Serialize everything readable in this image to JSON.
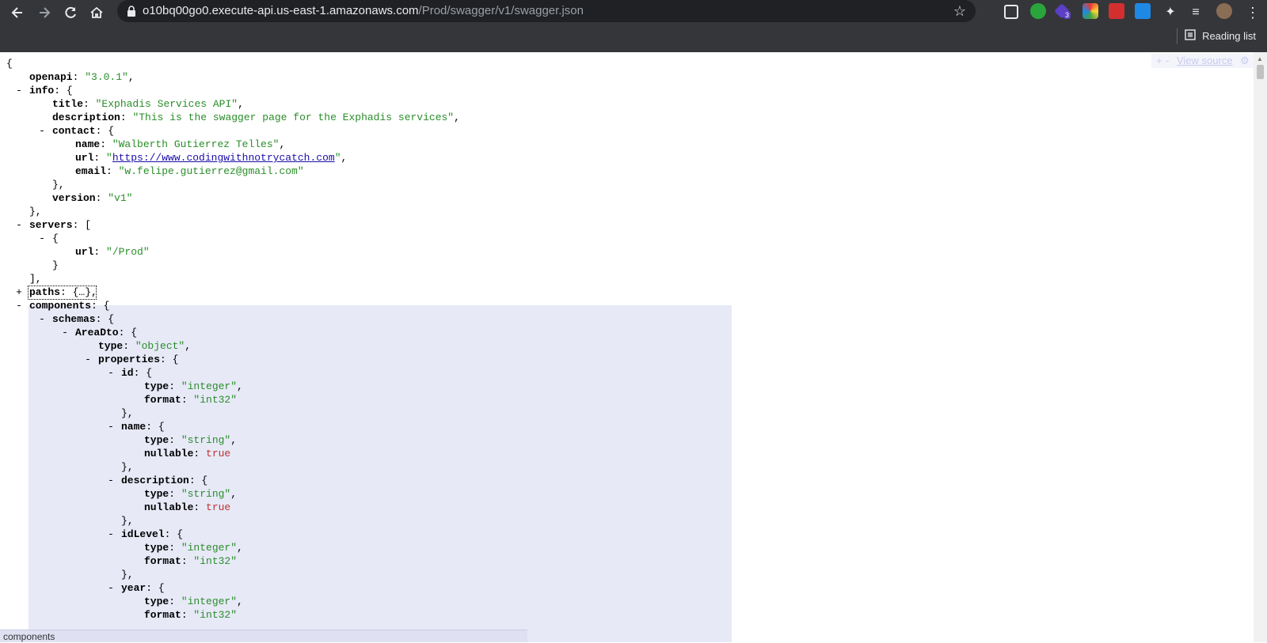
{
  "browser": {
    "url_host": "o10bq00go0.execute-api.us-east-1.amazonaws.com",
    "url_path": "/Prod/swagger/v1/swagger.json",
    "reading_list_label": "Reading list",
    "extension_badge": "3"
  },
  "viewer": {
    "view_source_label": "View source",
    "view_source_plus": "+",
    "view_source_minus": "-",
    "status_text": "components"
  },
  "json": {
    "openapi": "\"3.0.1\"",
    "info_title": "\"Exphadis Services API\"",
    "info_description": "\"This is the swagger page for the Exphadis services\"",
    "contact_name": "\"Walberth Gutierrez Telles\"",
    "contact_url": "https://www.codingwithnotrycatch.com",
    "contact_email": "\"w.felipe.gutierrez@gmail.com\"",
    "info_version": "\"v1\"",
    "server_url": "\"/Prod\"",
    "paths_collapsed": "{…}",
    "schema_name": "AreaDto",
    "schema_type": "\"object\"",
    "id_type": "\"integer\"",
    "id_format": "\"int32\"",
    "name_type": "\"string\"",
    "name_nullable": "true",
    "description_type": "\"string\"",
    "description_nullable": "true",
    "idlevel_type": "\"integer\"",
    "idlevel_format": "\"int32\"",
    "year_type": "\"integer\"",
    "year_format": "\"int32\""
  }
}
